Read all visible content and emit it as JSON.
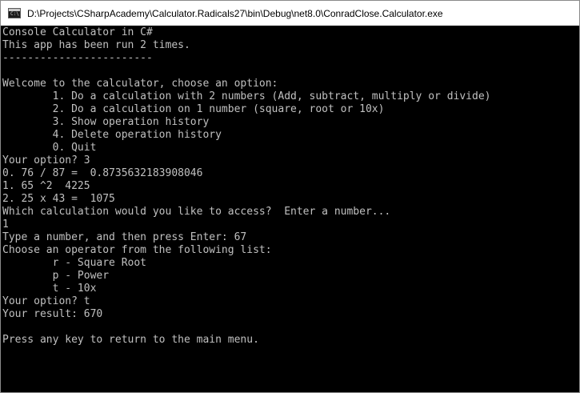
{
  "window": {
    "title": "D:\\Projects\\CSharpAcademy\\Calculator.Radicals27\\bin\\Debug\\net8.0\\ConradClose.Calculator.exe",
    "icon": "console-app-icon",
    "icon_text": "C:\\"
  },
  "console": {
    "lines": [
      "Console Calculator in C#",
      "This app has been run 2 times.",
      "------------------------",
      "",
      "Welcome to the calculator, choose an option:",
      "\t1. Do a calculation with 2 numbers (Add, subtract, multiply or divide)",
      "\t2. Do a calculation on 1 number (square, root or 10x)",
      "\t3. Show operation history",
      "\t4. Delete operation history",
      "\t0. Quit",
      "Your option? 3",
      "0. 76 / 87 =  0.8735632183908046",
      "1. 65 ^2  4225",
      "2. 25 x 43 =  1075",
      "Which calculation would you like to access?  Enter a number...",
      "1",
      "Type a number, and then press Enter: 67",
      "Choose an operator from the following list:",
      "\tr - Square Root",
      "\tp - Power",
      "\tt - 10x",
      "Your option? t",
      "Your result: 670",
      "",
      "Press any key to return to the main menu."
    ]
  }
}
